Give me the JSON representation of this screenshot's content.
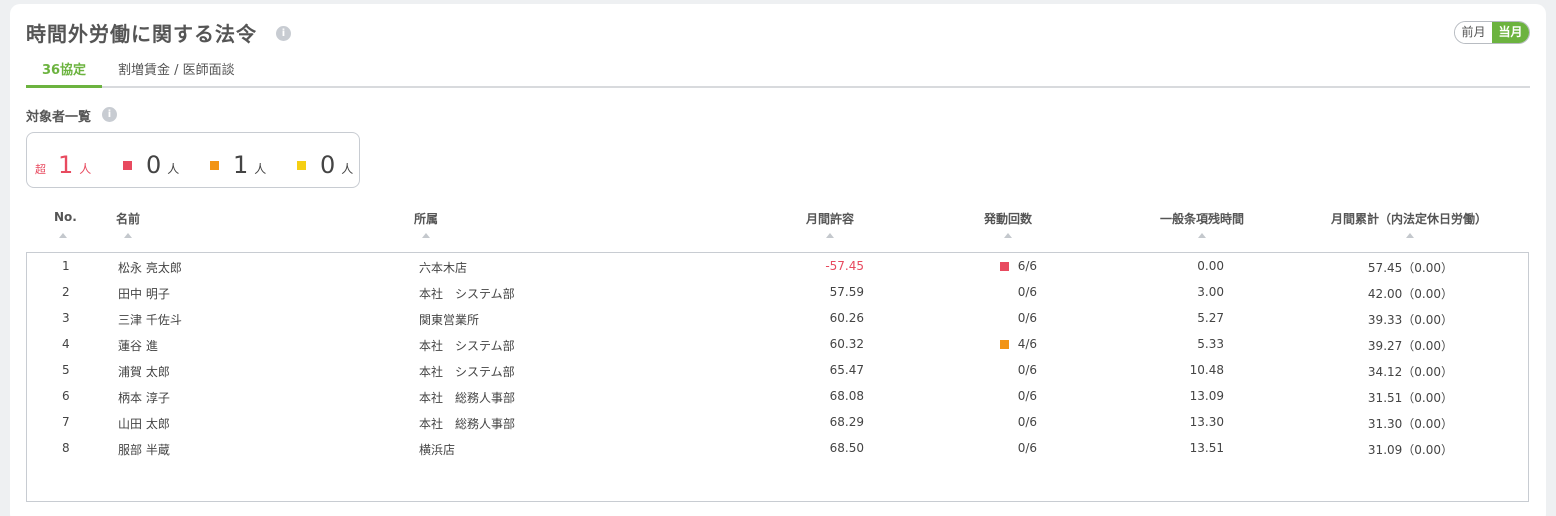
{
  "title": "時間外労働に関する法令",
  "month_toggle": {
    "prev": "前月",
    "current": "当月"
  },
  "tabs": [
    {
      "label": "36協定"
    },
    {
      "label": "割増賃金 / 医師面談"
    }
  ],
  "section_title": "対象者一覧",
  "summary": [
    {
      "marker": "超",
      "count": "1",
      "unit": "人",
      "color": "#e84a5f"
    },
    {
      "marker": "square",
      "count": "0",
      "unit": "人",
      "color": "#e84a5f"
    },
    {
      "marker": "square",
      "count": "1",
      "unit": "人",
      "color": "#f29414"
    },
    {
      "marker": "square",
      "count": "0",
      "unit": "人",
      "color": "#f5cf13"
    }
  ],
  "columns": {
    "no": "No.",
    "name": "名前",
    "dept": "所属",
    "allowance": "月間許容",
    "count": "発動回数",
    "general": "一般条項残時間",
    "total": "月間累計（内法定休日労働）"
  },
  "rows": [
    {
      "no": "1",
      "name": "松永 亮太郎",
      "dept": "六本木店",
      "allowance": "-57.45",
      "count": "6/6",
      "mark": "#e84a5f",
      "general": "0.00",
      "total": "57.45（0.00）"
    },
    {
      "no": "2",
      "name": "田中 明子",
      "dept": "本社　システム部",
      "allowance": "57.59",
      "count": "0/6",
      "mark": "",
      "general": "3.00",
      "total": "42.00（0.00）"
    },
    {
      "no": "3",
      "name": "三津 千佐斗",
      "dept": "関東営業所",
      "allowance": "60.26",
      "count": "0/6",
      "mark": "",
      "general": "5.27",
      "total": "39.33（0.00）"
    },
    {
      "no": "4",
      "name": "蓮谷 進",
      "dept": "本社　システム部",
      "allowance": "60.32",
      "count": "4/6",
      "mark": "#f29414",
      "general": "5.33",
      "total": "39.27（0.00）"
    },
    {
      "no": "5",
      "name": "浦賀 太郎",
      "dept": "本社　システム部",
      "allowance": "65.47",
      "count": "0/6",
      "mark": "",
      "general": "10.48",
      "total": "34.12（0.00）"
    },
    {
      "no": "6",
      "name": "柄本 淳子",
      "dept": "本社　総務人事部",
      "allowance": "68.08",
      "count": "0/6",
      "mark": "",
      "general": "13.09",
      "total": "31.51（0.00）"
    },
    {
      "no": "7",
      "name": "山田 太郎",
      "dept": "本社　総務人事部",
      "allowance": "68.29",
      "count": "0/6",
      "mark": "",
      "general": "13.30",
      "total": "31.30（0.00）"
    },
    {
      "no": "8",
      "name": "服部 半蔵",
      "dept": "横浜店",
      "allowance": "68.50",
      "count": "0/6",
      "mark": "",
      "general": "13.51",
      "total": "31.09（0.00）"
    }
  ]
}
